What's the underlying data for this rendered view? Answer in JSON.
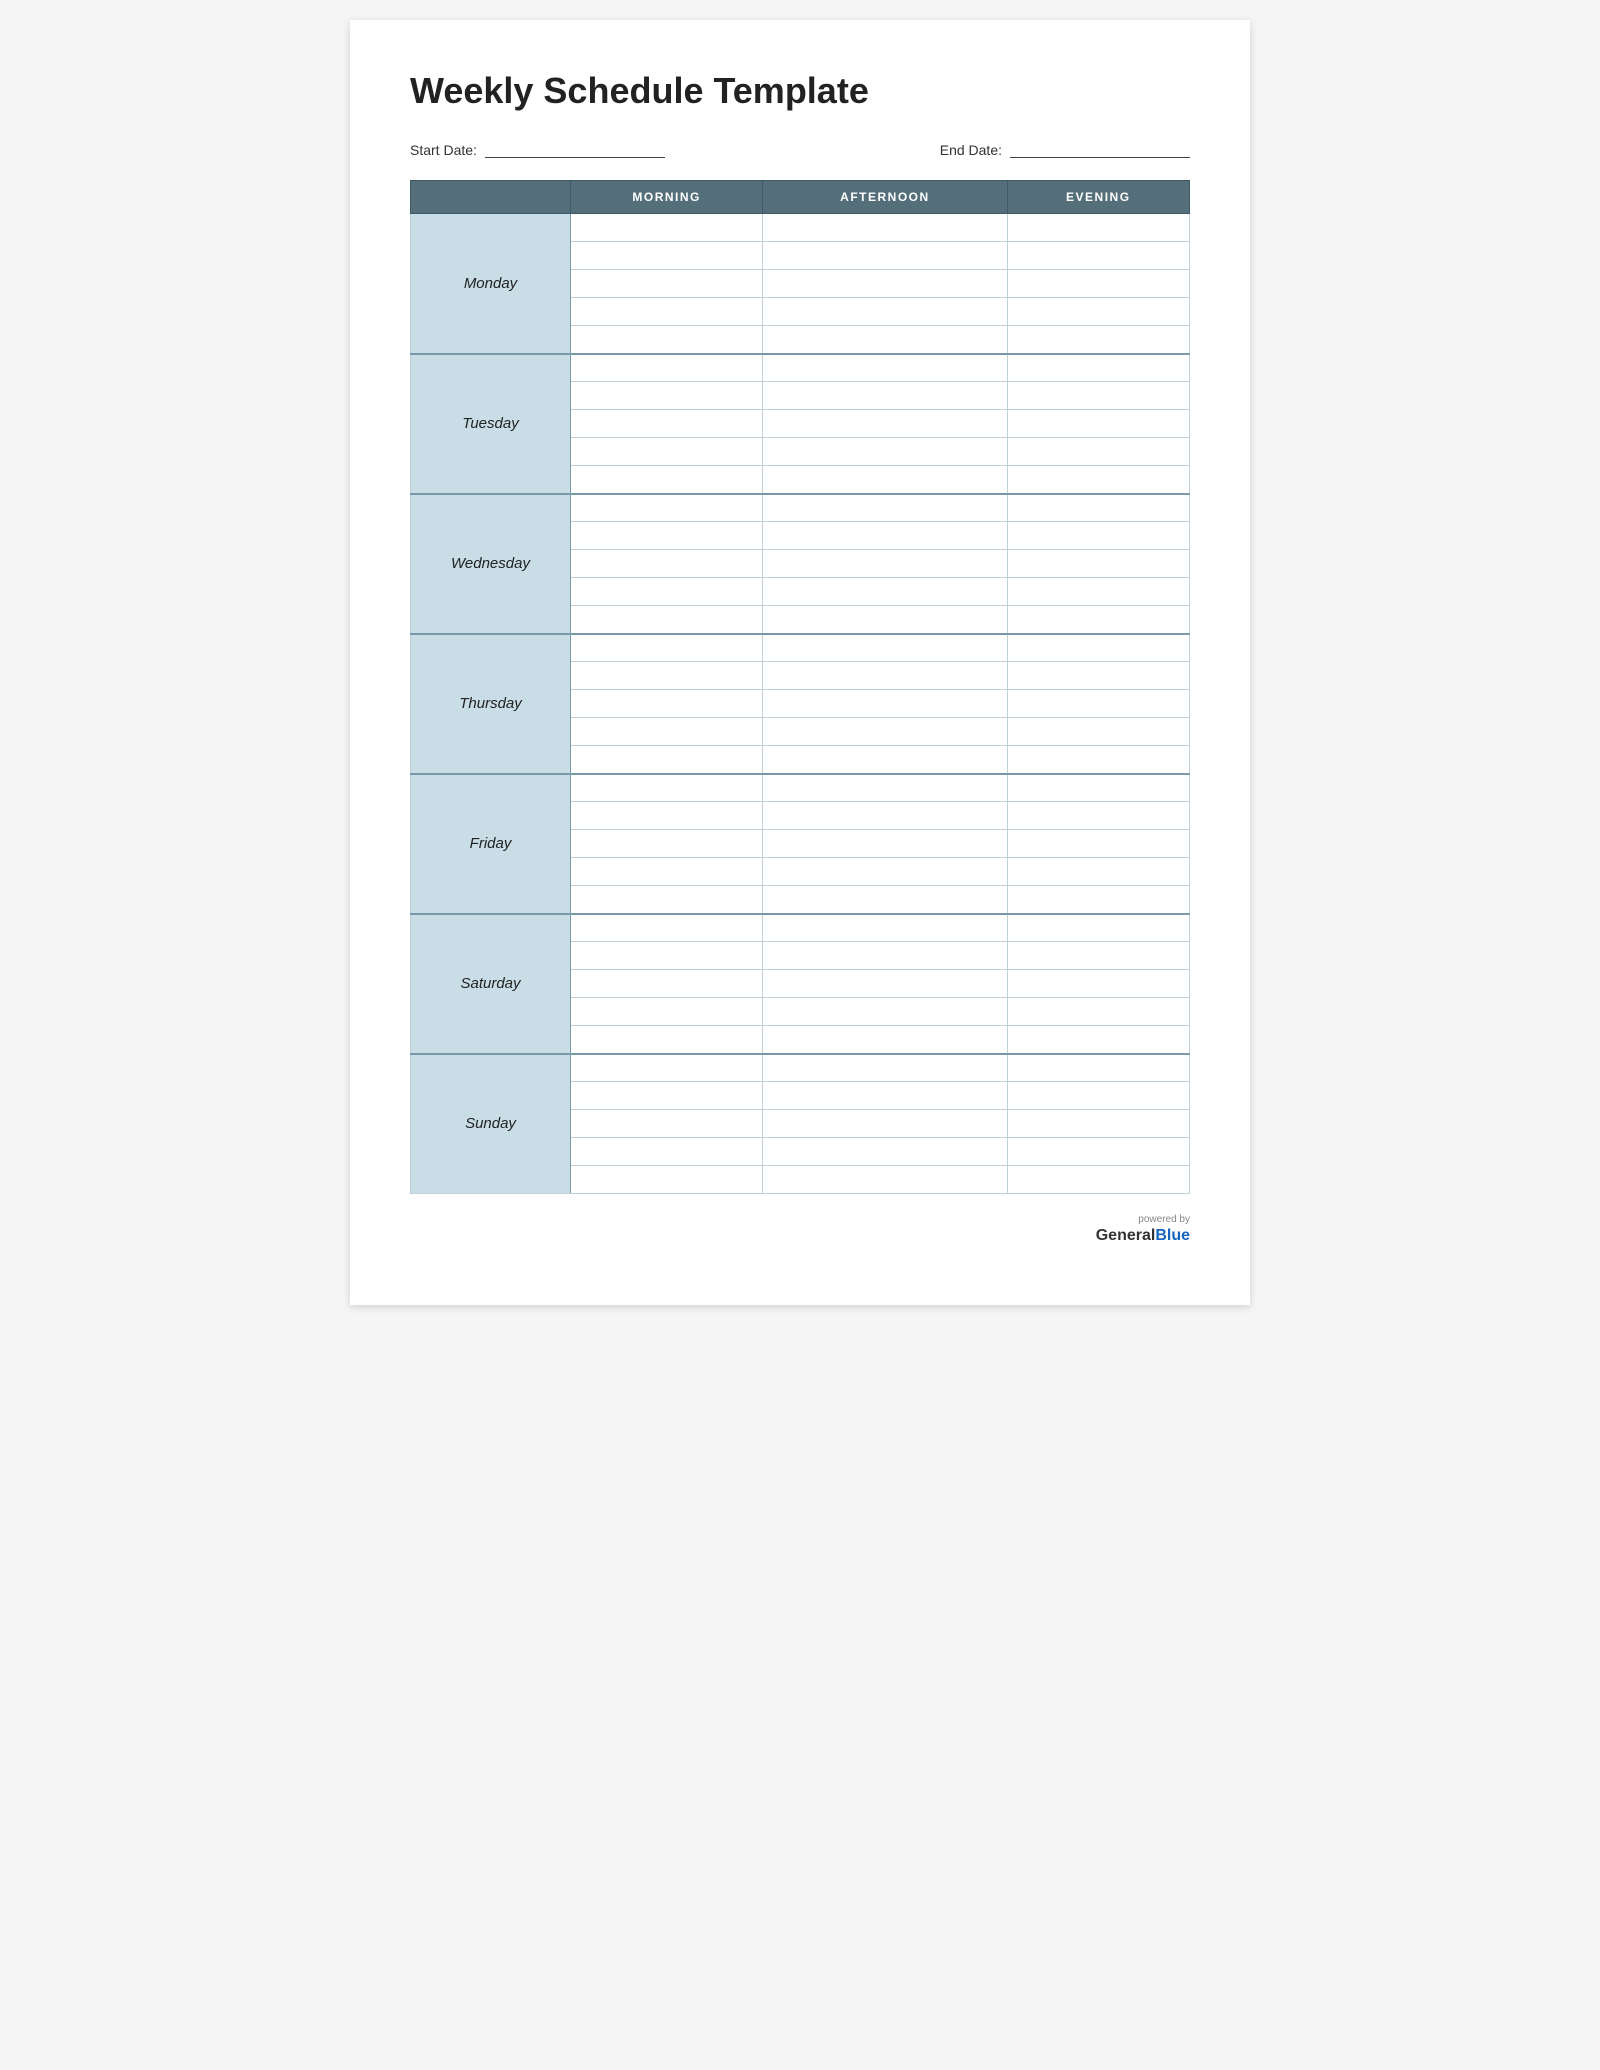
{
  "title": "Weekly Schedule Template",
  "start_date_label": "Start Date:",
  "end_date_label": "End Date:",
  "columns": {
    "day": "",
    "morning": "MORNING",
    "afternoon": "AFTERNOON",
    "evening": "EVENING"
  },
  "days": [
    {
      "name": "Monday"
    },
    {
      "name": "Tuesday"
    },
    {
      "name": "Wednesday"
    },
    {
      "name": "Thursday"
    },
    {
      "name": "Friday"
    },
    {
      "name": "Saturday"
    },
    {
      "name": "Sunday"
    }
  ],
  "rows_per_day": 5,
  "powered_by": "powered by",
  "brand_general": "General",
  "brand_blue": "Blue"
}
